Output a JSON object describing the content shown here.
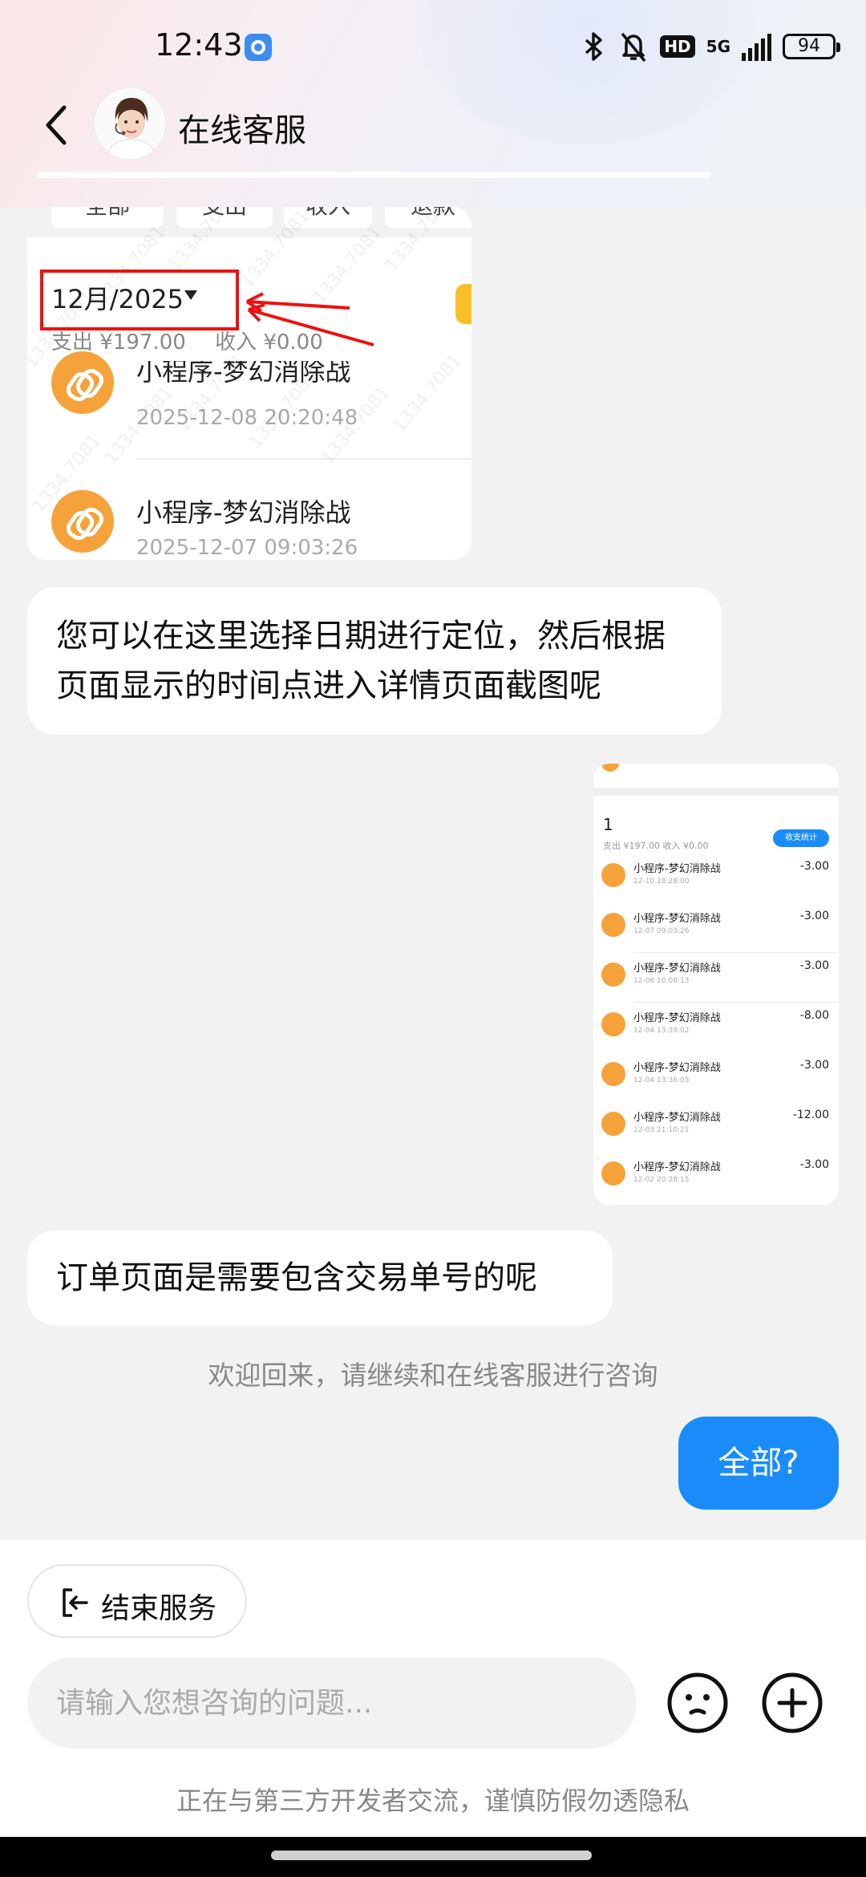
{
  "status_bar": {
    "time": "12:43",
    "hd": "HD",
    "network": "5G",
    "battery": "94",
    "icons": [
      "qq-icon",
      "bluetooth-icon",
      "bell-muted-icon",
      "signal-icon",
      "battery-icon"
    ]
  },
  "header": {
    "title": "在线客服",
    "back_icon": "chevron-left-icon",
    "avatar": "agent-avatar"
  },
  "messages": {
    "screenshot1": {
      "chips": [
        "全部",
        "支出",
        "收入",
        "退款"
      ],
      "date": "12月/2025",
      "expense": "支出 ¥197.00",
      "income": "收入 ¥0.00",
      "items": [
        {
          "name": "小程序-梦幻消除战",
          "time": "2025-12-08 20:20:48"
        },
        {
          "name": "小程序-梦幻消除战",
          "time": "2025-12-07 09:03:26"
        }
      ],
      "watermark": "1334.7081"
    },
    "agent_text_1": "您可以在这里选择日期进行定位，然后根据页面显示的时间点进入详情页面截图呢",
    "screenshot2": {
      "month": "1",
      "summary": "支出 ¥197.00  收入 ¥0.00",
      "button": "收支统计",
      "rows": [
        {
          "name": "小程序-梦幻消除战",
          "time": "12-10 18:28:00",
          "amount": "-3.00"
        },
        {
          "name": "小程序-梦幻消除战",
          "time": "12-07 09:03:26",
          "amount": "-3.00"
        },
        {
          "name": "小程序-梦幻消除战",
          "time": "12-06 10:08:13",
          "amount": "-3.00"
        },
        {
          "name": "小程序-梦幻消除战",
          "time": "12-04 13:39:02",
          "amount": "-8.00"
        },
        {
          "name": "小程序-梦幻消除战",
          "time": "12-04 13:36:05",
          "amount": "-3.00"
        },
        {
          "name": "小程序-梦幻消除战",
          "time": "12-03 21:10:21",
          "amount": "-12.00"
        },
        {
          "name": "小程序-梦幻消除战",
          "time": "12-02 20:28:15",
          "amount": "-3.00"
        }
      ]
    },
    "agent_text_2": "订单页面是需要包含交易单号的呢",
    "system_text": "欢迎回来，请继续和在线客服进行咨询",
    "user_text": "全部?"
  },
  "bottom": {
    "end_service": "结束服务",
    "input_placeholder": "请输入您想咨询的问题...",
    "emoji_icon": "emoji-icon",
    "plus_icon": "plus-circle-icon",
    "footer": "正在与第三方开发者交流，谨慎防假勿透隐私"
  },
  "colors": {
    "accent": "#1a8cfa",
    "orange": "#f6a23a",
    "highlight_red": "#ee1111"
  }
}
